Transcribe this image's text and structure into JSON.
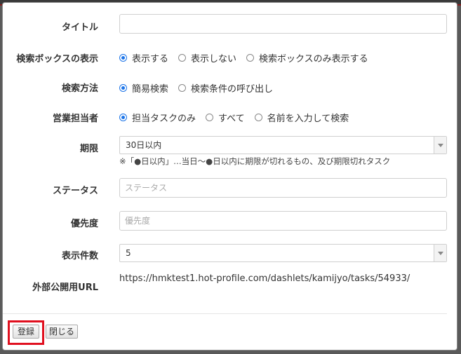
{
  "form": {
    "title_label": "タイトル",
    "title_value": "",
    "searchbox_label": "検索ボックスの表示",
    "searchbox_options": [
      "表示する",
      "表示しない",
      "検索ボックスのみ表示する"
    ],
    "searchbox_selected": 0,
    "method_label": "検索方法",
    "method_options": [
      "簡易検索",
      "検索条件の呼び出し"
    ],
    "method_selected": 0,
    "sales_label": "営業担当者",
    "sales_options": [
      "担当タスクのみ",
      "すべて",
      "名前を入力して検索"
    ],
    "sales_selected": 0,
    "period_label": "期限",
    "period_value": "30日以内",
    "period_note": "※「●日以内」…当日～●日以内に期限が切れるもの、及び期限切れタスク",
    "status_label": "ステータス",
    "status_placeholder": "ステータス",
    "priority_label": "優先度",
    "priority_placeholder": "優先度",
    "count_label": "表示件数",
    "count_value": "5",
    "url_label": "外部公開用URL",
    "url_value": "https://hmktest1.hot-profile.com/dashlets/kamijyo/tasks/54933/"
  },
  "footer": {
    "register_label": "登録",
    "close_label": "閉じる"
  },
  "colors": {
    "accent": "#1a73e8",
    "highlight": "#e0101f"
  }
}
